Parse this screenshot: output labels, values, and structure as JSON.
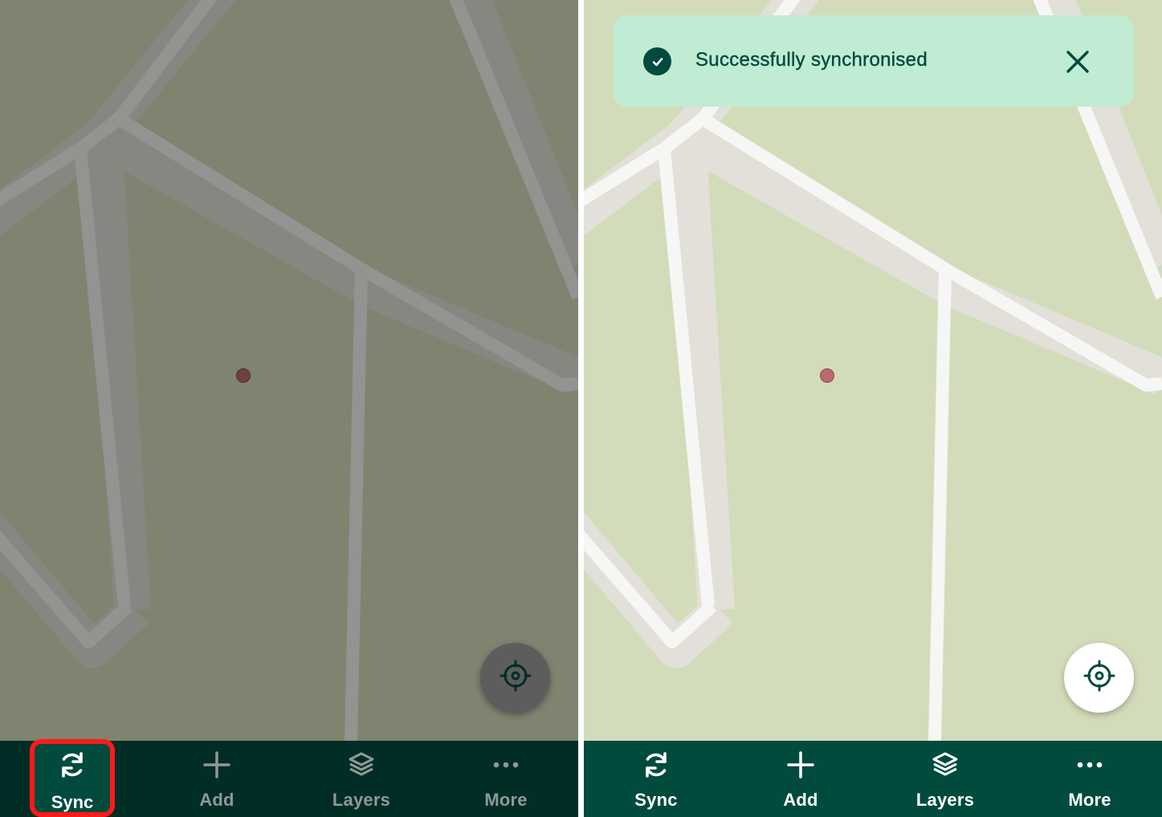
{
  "before": {
    "map": {
      "point_marker_icon": "map-point-marker"
    },
    "locate_icon": "crosshair-icon",
    "nav": [
      {
        "id": "sync",
        "label": "Sync",
        "icon": "sync-icon"
      },
      {
        "id": "add",
        "label": "Add",
        "icon": "plus-icon"
      },
      {
        "id": "layers",
        "label": "Layers",
        "icon": "layers-icon"
      },
      {
        "id": "more",
        "label": "More",
        "icon": "more-dots-icon"
      }
    ],
    "highlight_color": "#ff1a1a"
  },
  "after": {
    "toast": {
      "message": "Successfully synchronised",
      "status_icon": "check-circle-icon",
      "close_icon": "close-icon",
      "background": "#c0ecd3"
    },
    "locate_icon": "crosshair-icon",
    "nav": [
      {
        "id": "sync",
        "label": "Sync",
        "icon": "sync-icon"
      },
      {
        "id": "add",
        "label": "Add",
        "icon": "plus-icon"
      },
      {
        "id": "layers",
        "label": "Layers",
        "icon": "layers-icon"
      },
      {
        "id": "more",
        "label": "More",
        "icon": "more-dots-icon"
      }
    ]
  },
  "colors": {
    "brand_dark_green": "#004b3e",
    "map_land": "#d2dcba",
    "map_road": "#f6f6f4",
    "map_road_casing": "#e2e0d8",
    "point_marker": "#b96a6f"
  }
}
